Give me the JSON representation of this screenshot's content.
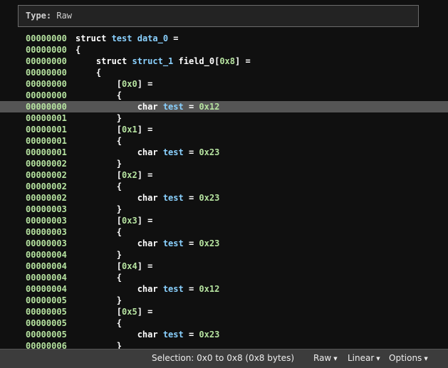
{
  "header": {
    "type_label": "Type:",
    "type_value": "Raw"
  },
  "lines": [
    {
      "addr": "00000000",
      "tokens": [
        {
          "t": "struct ",
          "c": "kw"
        },
        {
          "t": "test",
          "c": "idt"
        },
        {
          "t": " ",
          "c": "kw"
        },
        {
          "t": "data_0",
          "c": "idt"
        },
        {
          "t": " =",
          "c": "kw"
        }
      ]
    },
    {
      "addr": "00000000",
      "tokens": [
        {
          "t": "{",
          "c": "kw"
        }
      ]
    },
    {
      "addr": "00000000",
      "tokens": [
        {
          "t": "    struct ",
          "c": "kw"
        },
        {
          "t": "struct_1",
          "c": "idt"
        },
        {
          "t": " field_0[",
          "c": "kw"
        },
        {
          "t": "0x8",
          "c": "num"
        },
        {
          "t": "] =",
          "c": "kw"
        }
      ]
    },
    {
      "addr": "00000000",
      "tokens": [
        {
          "t": "    {",
          "c": "kw"
        }
      ]
    },
    {
      "addr": "00000000",
      "tokens": [
        {
          "t": "        [",
          "c": "kw"
        },
        {
          "t": "0x0",
          "c": "num"
        },
        {
          "t": "] =",
          "c": "kw"
        }
      ]
    },
    {
      "addr": "00000000",
      "tokens": [
        {
          "t": "        {",
          "c": "kw"
        }
      ]
    },
    {
      "addr": "00000000",
      "highlight": true,
      "tokens": [
        {
          "t": "            char ",
          "c": "kw"
        },
        {
          "t": "test",
          "c": "idt"
        },
        {
          "t": " = ",
          "c": "kw"
        },
        {
          "t": "0x12",
          "c": "num"
        }
      ]
    },
    {
      "addr": "00000001",
      "tokens": [
        {
          "t": "        }",
          "c": "kw"
        }
      ]
    },
    {
      "addr": "00000001",
      "tokens": [
        {
          "t": "        [",
          "c": "kw"
        },
        {
          "t": "0x1",
          "c": "num"
        },
        {
          "t": "] =",
          "c": "kw"
        }
      ]
    },
    {
      "addr": "00000001",
      "tokens": [
        {
          "t": "        {",
          "c": "kw"
        }
      ]
    },
    {
      "addr": "00000001",
      "tokens": [
        {
          "t": "            char ",
          "c": "kw"
        },
        {
          "t": "test",
          "c": "idt"
        },
        {
          "t": " = ",
          "c": "kw"
        },
        {
          "t": "0x23",
          "c": "num"
        }
      ]
    },
    {
      "addr": "00000002",
      "tokens": [
        {
          "t": "        }",
          "c": "kw"
        }
      ]
    },
    {
      "addr": "00000002",
      "tokens": [
        {
          "t": "        [",
          "c": "kw"
        },
        {
          "t": "0x2",
          "c": "num"
        },
        {
          "t": "] =",
          "c": "kw"
        }
      ]
    },
    {
      "addr": "00000002",
      "tokens": [
        {
          "t": "        {",
          "c": "kw"
        }
      ]
    },
    {
      "addr": "00000002",
      "tokens": [
        {
          "t": "            char ",
          "c": "kw"
        },
        {
          "t": "test",
          "c": "idt"
        },
        {
          "t": " = ",
          "c": "kw"
        },
        {
          "t": "0x23",
          "c": "num"
        }
      ]
    },
    {
      "addr": "00000003",
      "tokens": [
        {
          "t": "        }",
          "c": "kw"
        }
      ]
    },
    {
      "addr": "00000003",
      "tokens": [
        {
          "t": "        [",
          "c": "kw"
        },
        {
          "t": "0x3",
          "c": "num"
        },
        {
          "t": "] =",
          "c": "kw"
        }
      ]
    },
    {
      "addr": "00000003",
      "tokens": [
        {
          "t": "        {",
          "c": "kw"
        }
      ]
    },
    {
      "addr": "00000003",
      "tokens": [
        {
          "t": "            char ",
          "c": "kw"
        },
        {
          "t": "test",
          "c": "idt"
        },
        {
          "t": " = ",
          "c": "kw"
        },
        {
          "t": "0x23",
          "c": "num"
        }
      ]
    },
    {
      "addr": "00000004",
      "tokens": [
        {
          "t": "        }",
          "c": "kw"
        }
      ]
    },
    {
      "addr": "00000004",
      "tokens": [
        {
          "t": "        [",
          "c": "kw"
        },
        {
          "t": "0x4",
          "c": "num"
        },
        {
          "t": "] =",
          "c": "kw"
        }
      ]
    },
    {
      "addr": "00000004",
      "tokens": [
        {
          "t": "        {",
          "c": "kw"
        }
      ]
    },
    {
      "addr": "00000004",
      "tokens": [
        {
          "t": "            char ",
          "c": "kw"
        },
        {
          "t": "test",
          "c": "idt"
        },
        {
          "t": " = ",
          "c": "kw"
        },
        {
          "t": "0x12",
          "c": "num"
        }
      ]
    },
    {
      "addr": "00000005",
      "tokens": [
        {
          "t": "        }",
          "c": "kw"
        }
      ]
    },
    {
      "addr": "00000005",
      "tokens": [
        {
          "t": "        [",
          "c": "kw"
        },
        {
          "t": "0x5",
          "c": "num"
        },
        {
          "t": "] =",
          "c": "kw"
        }
      ]
    },
    {
      "addr": "00000005",
      "tokens": [
        {
          "t": "        {",
          "c": "kw"
        }
      ]
    },
    {
      "addr": "00000005",
      "tokens": [
        {
          "t": "            char ",
          "c": "kw"
        },
        {
          "t": "test",
          "c": "idt"
        },
        {
          "t": " = ",
          "c": "kw"
        },
        {
          "t": "0x23",
          "c": "num"
        }
      ]
    },
    {
      "addr": "00000006",
      "tokens": [
        {
          "t": "        }",
          "c": "kw"
        }
      ]
    }
  ],
  "status": {
    "selection": "Selection: 0x0 to 0x8 (0x8 bytes)",
    "raw_label": "Raw",
    "linear_label": "Linear",
    "options_label": "Options",
    "caret": "▼"
  },
  "colors": {
    "address": "#b6e3a0",
    "identifier": "#8ad1ff",
    "keyword": "#ffffff",
    "highlight_row": "#555555",
    "background": "#101010",
    "status_bar": "#3c3c3c"
  }
}
